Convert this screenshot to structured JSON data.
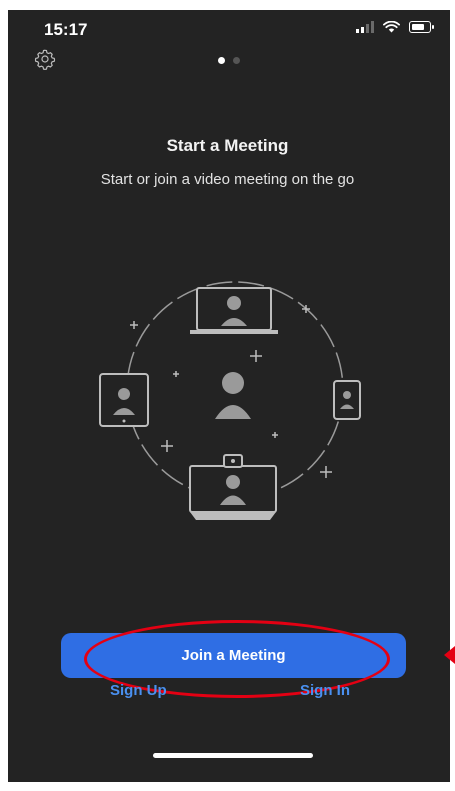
{
  "status_bar": {
    "time": "15:17"
  },
  "icons": {
    "settings": "gear-icon",
    "signal": "signal-icon",
    "wifi": "wifi-icon",
    "battery": "battery-icon"
  },
  "pager": {
    "total": 2,
    "active": 1
  },
  "onboarding": {
    "title": "Start a Meeting",
    "subtitle": "Start or join a video meeting on the go"
  },
  "actions": {
    "join_label": "Join a Meeting",
    "sign_up_label": "Sign Up",
    "sign_in_label": "Sign In"
  },
  "colors": {
    "background": "#232323",
    "primary_button": "#2f6ee4",
    "link": "#4a90f0",
    "annotation": "#e40013"
  }
}
